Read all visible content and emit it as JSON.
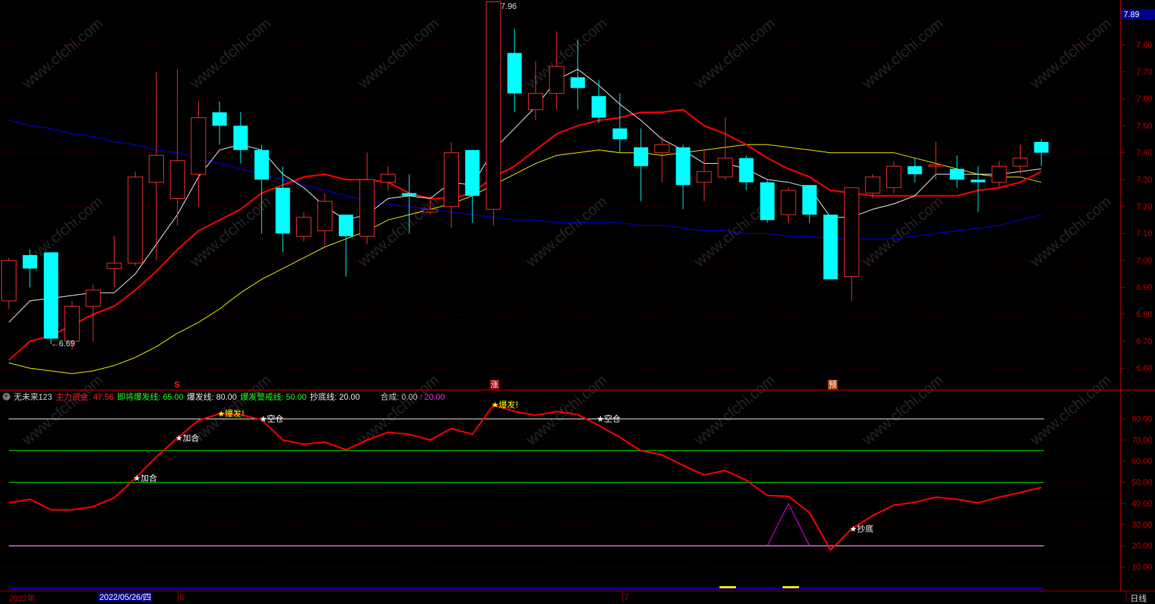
{
  "colors": {
    "up": "#ff3232",
    "down": "#00ffff",
    "ma5": "#ffffff",
    "ma10": "#ff0000",
    "ma20": "#ffff00",
    "ma60": "#0000ff",
    "axis": "#a00000",
    "grid": "#800000",
    "indicator": "#ff0000"
  },
  "price_panel": {
    "current_price": "7.89",
    "high_label": "7.96",
    "low_label": "←6.69",
    "signals": [
      {
        "text": "S",
        "candle": 8
      },
      {
        "text": "涨",
        "candle": 23
      },
      {
        "text": "预",
        "candle": 39
      }
    ]
  },
  "indicator_header": {
    "name": "无未来123",
    "main_fund_label": "主力资金:",
    "main_fund_value": "47.56",
    "near_burst_label": "即将爆发线:",
    "near_burst_value": "65.00",
    "burst_label": "爆发线:",
    "burst_value": "80.00",
    "warn_label": "爆发警戒线:",
    "warn_value": "50.00",
    "bottom_label": "抄底线:",
    "bottom_value": "20.00",
    "composite_label": "合成:",
    "composite_value1": "0.00",
    "composite_value2": ": 20.00"
  },
  "time_axis": {
    "year": "2022年",
    "cursor_date": "2022/05/26/四",
    "month_6": "6",
    "month_7": "7",
    "period": "日线"
  },
  "watermark": "www.cfchi.com",
  "chart_data": [
    {
      "type": "candlestick",
      "title": "",
      "ylim": [
        6.55,
        7.97
      ],
      "yticks": [
        "7.80",
        "7.70",
        "7.60",
        "7.50",
        "7.40",
        "7.30",
        "7.20",
        "7.10",
        "7.00",
        "6.90",
        "6.80",
        "6.70",
        "6.60"
      ],
      "candles_ochl": [
        [
          6.85,
          7.0,
          7.01,
          6.82
        ],
        [
          7.02,
          6.97,
          7.04,
          6.9
        ],
        [
          7.03,
          6.71,
          7.03,
          6.69
        ],
        [
          6.7,
          6.83,
          6.85,
          6.67
        ],
        [
          6.83,
          6.89,
          6.91,
          6.7
        ],
        [
          6.97,
          6.99,
          7.09,
          6.9
        ],
        [
          6.99,
          7.31,
          7.33,
          6.98
        ],
        [
          7.29,
          7.39,
          7.7,
          7.0
        ],
        [
          7.23,
          7.37,
          7.71,
          7.13
        ],
        [
          7.32,
          7.53,
          7.59,
          7.2
        ],
        [
          7.55,
          7.5,
          7.59,
          7.43
        ],
        [
          7.5,
          7.41,
          7.55,
          7.36
        ],
        [
          7.41,
          7.3,
          7.43,
          7.1
        ],
        [
          7.27,
          7.1,
          7.35,
          7.03
        ],
        [
          7.09,
          7.16,
          7.18,
          7.07
        ],
        [
          7.11,
          7.22,
          7.25,
          7.05
        ],
        [
          7.17,
          7.09,
          7.17,
          6.94
        ],
        [
          7.09,
          7.3,
          7.4,
          7.06
        ],
        [
          7.29,
          7.32,
          7.35,
          7.26
        ],
        [
          7.25,
          7.24,
          7.32,
          7.1
        ],
        [
          7.18,
          7.19,
          7.24,
          7.17
        ],
        [
          7.2,
          7.4,
          7.44,
          7.12
        ],
        [
          7.41,
          7.24,
          7.41,
          7.14
        ],
        [
          7.19,
          7.96,
          7.96,
          7.13
        ],
        [
          7.77,
          7.62,
          7.86,
          7.55
        ],
        [
          7.56,
          7.62,
          7.74,
          7.52
        ],
        [
          7.62,
          7.72,
          7.85,
          7.56
        ],
        [
          7.68,
          7.64,
          7.82,
          7.56
        ],
        [
          7.61,
          7.53,
          7.67,
          7.51
        ],
        [
          7.49,
          7.45,
          7.62,
          7.4
        ],
        [
          7.42,
          7.35,
          7.49,
          7.22
        ],
        [
          7.4,
          7.43,
          7.46,
          7.29
        ],
        [
          7.42,
          7.28,
          7.43,
          7.19
        ],
        [
          7.29,
          7.33,
          7.41,
          7.22
        ],
        [
          7.31,
          7.38,
          7.53,
          7.3
        ],
        [
          7.38,
          7.29,
          7.39,
          7.26
        ],
        [
          7.29,
          7.15,
          7.3,
          7.14
        ],
        [
          7.17,
          7.26,
          7.27,
          7.14
        ],
        [
          7.28,
          7.17,
          7.28,
          7.14
        ],
        [
          7.17,
          6.93,
          7.17,
          6.93
        ],
        [
          6.94,
          7.27,
          7.27,
          6.85
        ],
        [
          7.25,
          7.31,
          7.32,
          7.23
        ],
        [
          7.27,
          7.35,
          7.37,
          7.25
        ],
        [
          7.35,
          7.32,
          7.38,
          7.29
        ],
        [
          7.35,
          7.355,
          7.44,
          7.3
        ],
        [
          7.34,
          7.3,
          7.39,
          7.27
        ],
        [
          7.3,
          7.29,
          7.35,
          7.18
        ],
        [
          7.29,
          7.35,
          7.37,
          7.27
        ],
        [
          7.35,
          7.38,
          7.43,
          7.32
        ],
        [
          7.44,
          7.4,
          7.45,
          7.35
        ]
      ],
      "series": [
        {
          "name": "MA5",
          "color": "#ffffff",
          "values": [
            6.77,
            6.85,
            6.86,
            6.87,
            6.88,
            6.88,
            6.95,
            7.06,
            7.17,
            7.31,
            7.41,
            7.43,
            7.41,
            7.32,
            7.27,
            7.2,
            7.15,
            7.17,
            7.23,
            7.24,
            7.23,
            7.29,
            7.28,
            7.41,
            7.49,
            7.57,
            7.67,
            7.71,
            7.65,
            7.58,
            7.52,
            7.45,
            7.41,
            7.36,
            7.36,
            7.34,
            7.3,
            7.29,
            7.27,
            7.16,
            7.16,
            7.19,
            7.21,
            7.24,
            7.32,
            7.32,
            7.32,
            7.32,
            7.33,
            7.34
          ]
        },
        {
          "name": "MA10",
          "color": "#ff0000",
          "values": [
            6.63,
            6.7,
            6.72,
            6.76,
            6.8,
            6.83,
            6.89,
            6.96,
            7.04,
            7.11,
            7.15,
            7.19,
            7.25,
            7.28,
            7.31,
            7.32,
            7.3,
            7.3,
            7.29,
            7.25,
            7.23,
            7.23,
            7.25,
            7.31,
            7.35,
            7.41,
            7.47,
            7.5,
            7.52,
            7.53,
            7.55,
            7.55,
            7.56,
            7.5,
            7.47,
            7.43,
            7.38,
            7.34,
            7.31,
            7.26,
            7.25,
            7.24,
            7.24,
            7.24,
            7.24,
            7.24,
            7.26,
            7.27,
            7.29,
            7.33
          ]
        },
        {
          "name": "MA20",
          "color": "#ffff00",
          "values": [
            6.62,
            6.6,
            6.59,
            6.58,
            6.59,
            6.61,
            6.64,
            6.68,
            6.73,
            6.77,
            6.82,
            6.88,
            6.93,
            6.97,
            7.01,
            7.05,
            7.08,
            7.11,
            7.15,
            7.17,
            7.19,
            7.21,
            7.24,
            7.28,
            7.32,
            7.36,
            7.39,
            7.4,
            7.41,
            7.4,
            7.4,
            7.39,
            7.4,
            7.41,
            7.42,
            7.43,
            7.43,
            7.42,
            7.41,
            7.4,
            7.4,
            7.4,
            7.4,
            7.38,
            7.36,
            7.34,
            7.32,
            7.31,
            7.31,
            7.29
          ]
        },
        {
          "name": "MA60",
          "color": "#0000ff",
          "values": [
            7.52,
            7.5,
            7.49,
            7.47,
            7.46,
            7.44,
            7.43,
            7.41,
            7.4,
            7.38,
            7.36,
            7.34,
            7.32,
            7.3,
            7.28,
            7.26,
            7.24,
            7.22,
            7.21,
            7.2,
            7.19,
            7.18,
            7.17,
            7.16,
            7.15,
            7.15,
            7.14,
            7.14,
            7.14,
            7.14,
            7.13,
            7.13,
            7.12,
            7.11,
            7.11,
            7.1,
            7.1,
            7.09,
            7.09,
            7.08,
            7.08,
            7.08,
            7.08,
            7.09,
            7.1,
            7.11,
            7.12,
            7.13,
            7.15,
            7.17
          ]
        }
      ]
    },
    {
      "type": "line",
      "title": "无未来123",
      "ylim": [
        0,
        90
      ],
      "yticks": [
        "80.00",
        "70.00",
        "60.00",
        "50.00",
        "40.00",
        "30.00",
        "20.00",
        "10.00"
      ],
      "series": [
        {
          "name": "主力资金",
          "color": "#ff0000",
          "values": [
            40.3,
            42,
            37,
            37,
            38.5,
            42.7,
            52,
            62,
            71,
            79.3,
            82.4,
            82,
            79.6,
            70,
            68,
            69,
            65.4,
            70,
            73.7,
            72.7,
            70,
            75.5,
            72.7,
            86.6,
            83.5,
            81.7,
            83.5,
            82,
            76.9,
            71.3,
            65,
            63,
            58,
            53.5,
            55.6,
            51,
            43.8,
            43.4,
            35.7,
            18,
            28,
            34.3,
            39.2,
            40.6,
            43,
            42,
            40.3,
            43,
            45.2,
            47.56
          ]
        }
      ],
      "hlines": [
        {
          "name": "爆发线",
          "value": 80,
          "color": "#ffffff"
        },
        {
          "name": "即将爆发线",
          "value": 65,
          "color": "#00ff00"
        },
        {
          "name": "爆发警戒线",
          "value": 50,
          "color": "#00ff00"
        },
        {
          "name": "抄底线",
          "value": 20,
          "color": "#ff66ff"
        }
      ],
      "composite_triangle": {
        "candles": [
          36,
          37,
          38
        ],
        "values": [
          20,
          40,
          20
        ],
        "color": "#ff00ff"
      },
      "annotations": [
        {
          "text": "★加合",
          "candle": 6,
          "color": "#ffffff"
        },
        {
          "text": "★加合",
          "candle": 8,
          "color": "#ffffff"
        },
        {
          "text": "★爆发!",
          "candle": 10,
          "color": "#ffff00"
        },
        {
          "text": "★空仓",
          "candle": 12,
          "color": "#ffffff"
        },
        {
          "text": "★爆发!",
          "candle": 23,
          "color": "#ffff00"
        },
        {
          "text": "★空仓",
          "candle": 28,
          "color": "#ffffff"
        },
        {
          "text": "★抄底",
          "candle": 40,
          "color": "#ffffff"
        }
      ]
    }
  ]
}
